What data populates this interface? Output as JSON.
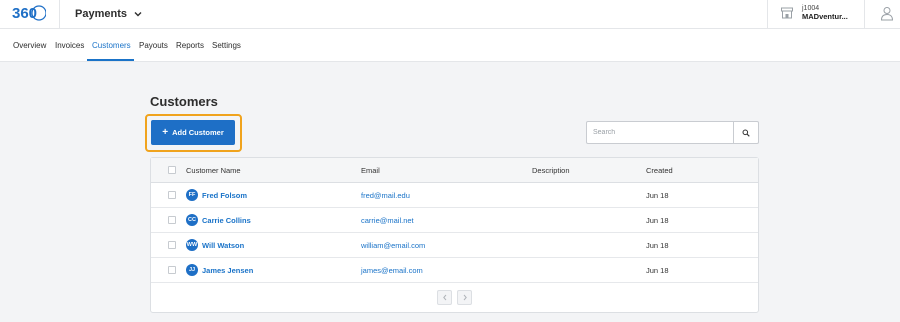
{
  "header": {
    "app_title": "Payments",
    "account_id": "j1004",
    "account_name": "MADventur..."
  },
  "nav": {
    "items": [
      {
        "label": "Overview"
      },
      {
        "label": "Invoices"
      },
      {
        "label": "Customers",
        "active": true
      },
      {
        "label": "Payouts"
      },
      {
        "label": "Reports"
      },
      {
        "label": "Settings"
      }
    ]
  },
  "page": {
    "title": "Customers",
    "add_button_label": "Add Customer",
    "search_placeholder": "Search"
  },
  "table": {
    "columns": [
      "Customer Name",
      "Email",
      "Description",
      "Created"
    ],
    "rows": [
      {
        "initials": "FF",
        "name": "Fred Folsom",
        "email": "fred@mail.edu",
        "description": "",
        "created": "Jun 18"
      },
      {
        "initials": "CC",
        "name": "Carrie Collins",
        "email": "carrie@mail.net",
        "description": "",
        "created": "Jun 18"
      },
      {
        "initials": "WW",
        "name": "Will Watson",
        "email": "william@email.com",
        "description": "",
        "created": "Jun 18"
      },
      {
        "initials": "JJ",
        "name": "James Jensen",
        "email": "james@email.com",
        "description": "",
        "created": "Jun 18"
      }
    ]
  },
  "colors": {
    "accent": "#1e6fc6",
    "link": "#1a73c8",
    "focus_ring": "#f0a31d"
  },
  "icons": [
    "logo-360",
    "chevron-down-icon",
    "store-icon",
    "user-icon",
    "plus-icon",
    "search-icon",
    "chevron-left-icon",
    "chevron-right-icon"
  ]
}
